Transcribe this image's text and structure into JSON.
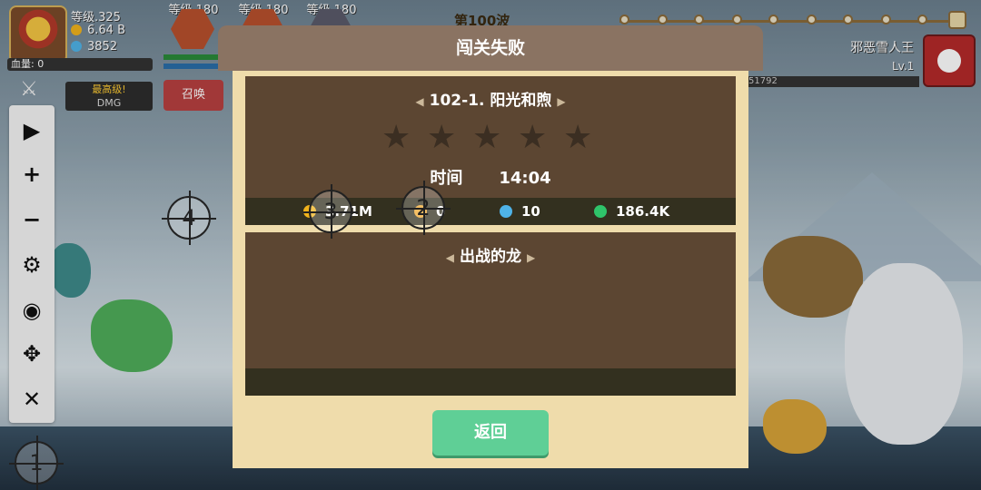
{
  "player": {
    "level": "等级.325",
    "gold": "6.64 B",
    "gems": "3852",
    "hp_label": "血量: 0"
  },
  "heroes": [
    {
      "level": "等级.180"
    },
    {
      "level": "等级.180"
    },
    {
      "level": "等级.180"
    }
  ],
  "actions": {
    "best": "最高级!",
    "dmg": "DMG",
    "summon": "召唤"
  },
  "stage": {
    "label": "第100波"
  },
  "boss": {
    "name": "邪恶雪人王",
    "level": "Lv.1",
    "hp": "51792"
  },
  "markers": [
    "1",
    "2",
    "3",
    "4"
  ],
  "modal": {
    "title": "闯关失败",
    "level_name": "102-1. 阳光和煦",
    "stars_total": 5,
    "stars_earned": 0,
    "time_label": "时间",
    "time_value": "14:04",
    "rewards": {
      "gold": "3.71M",
      "exp": "0",
      "gems": "10",
      "elixir": "186.4K"
    },
    "dragons_title": "出战的龙",
    "back_label": "返回"
  },
  "colors": {
    "accent_green": "#5fcf96",
    "panel_brown": "#5c4632",
    "header_brown": "#8a7362"
  }
}
